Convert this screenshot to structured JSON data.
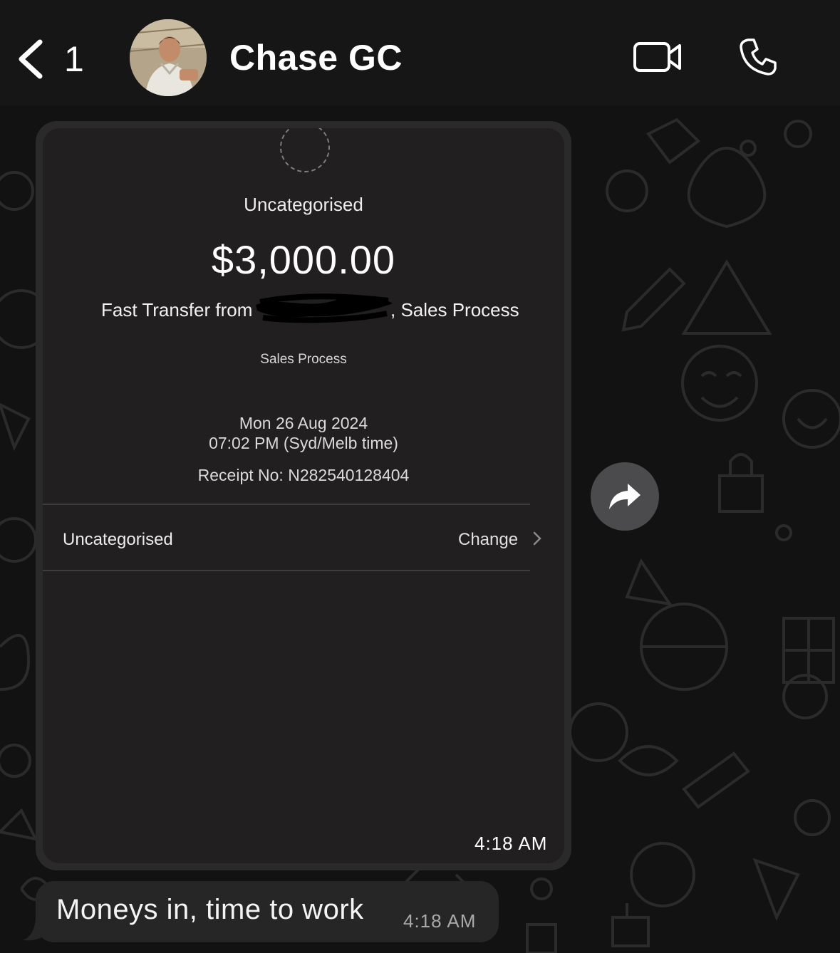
{
  "header": {
    "back_count": "1",
    "chat_title": "Chase GC",
    "icons": [
      "chevron-left-icon",
      "video-camera-icon",
      "phone-icon"
    ]
  },
  "image_message": {
    "receipt": {
      "category": "Uncategorised",
      "amount": "$3,000.00",
      "from_prefix": "Fast Transfer from",
      "from_suffix": ", Sales Process",
      "sub_label": "Sales Process",
      "date": "Mon 26 Aug 2024",
      "time": "07:02 PM (Syd/Melb time)",
      "receipt_no": "Receipt No: N282540128404",
      "row_label": "Uncategorised",
      "row_action": "Change"
    },
    "timestamp": "4:18 AM"
  },
  "text_message": {
    "text": "Moneys in, time to work",
    "timestamp": "4:18 AM"
  },
  "colors": {
    "background": "#121212",
    "header": "#161616",
    "bubble": "#262627",
    "receipt_bg": "#211f20"
  }
}
